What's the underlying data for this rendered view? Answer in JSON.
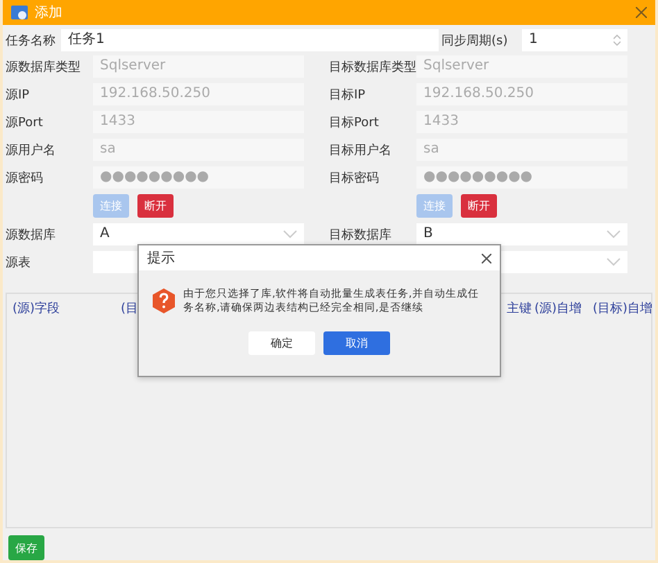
{
  "window": {
    "title": "添加"
  },
  "task": {
    "name_label": "任务名称",
    "name_value": "任务1",
    "period_label": "同步周期(s)",
    "period_value": "1"
  },
  "source": {
    "fields": [
      {
        "label": "源数据库类型",
        "value": "Sqlserver",
        "disabled": true
      },
      {
        "label": "源IP",
        "value": "192.168.50.250",
        "disabled": true
      },
      {
        "label": "源Port",
        "value": "1433",
        "disabled": true
      },
      {
        "label": "源用户名",
        "value": "sa",
        "disabled": true
      },
      {
        "label": "源密码",
        "value": "●●●●●●●●●",
        "disabled": true
      }
    ],
    "connect": {
      "label": "连接",
      "disabled": true
    },
    "disconnect": {
      "label": "断开",
      "disabled": false
    },
    "database": {
      "label": "源数据库",
      "value": "A"
    },
    "table": {
      "label": "源表"
    }
  },
  "target": {
    "fields": [
      {
        "label": "目标数据库类型",
        "value": "Sqlserver",
        "disabled": true
      },
      {
        "label": "目标IP",
        "value": "192.168.50.250",
        "disabled": true
      },
      {
        "label": "目标Port",
        "value": "1433",
        "disabled": true
      },
      {
        "label": "目标用户名",
        "value": "sa",
        "disabled": true
      },
      {
        "label": "目标密码",
        "value": "●●●●●●●●●",
        "disabled": true
      }
    ],
    "connect": {
      "label": "连接",
      "disabled": true
    },
    "disconnect": {
      "label": "断开",
      "disabled": false
    },
    "database": {
      "label": "目标数据库",
      "value": "B"
    }
  },
  "table": {
    "columns": [
      "(源)字段",
      "(目",
      "主键",
      "(源)自增",
      "(目标)自增"
    ]
  },
  "dialog": {
    "title": "提示",
    "message": "由于您只选择了库,软件将自动批量生成表任务,并自动生成任务名称,请确保两边表结构已经完全相同,是否继续",
    "buttons": [
      {
        "label": "确定",
        "kind": "default"
      },
      {
        "label": "取消",
        "kind": "primary"
      }
    ]
  },
  "save_button": "保存"
}
